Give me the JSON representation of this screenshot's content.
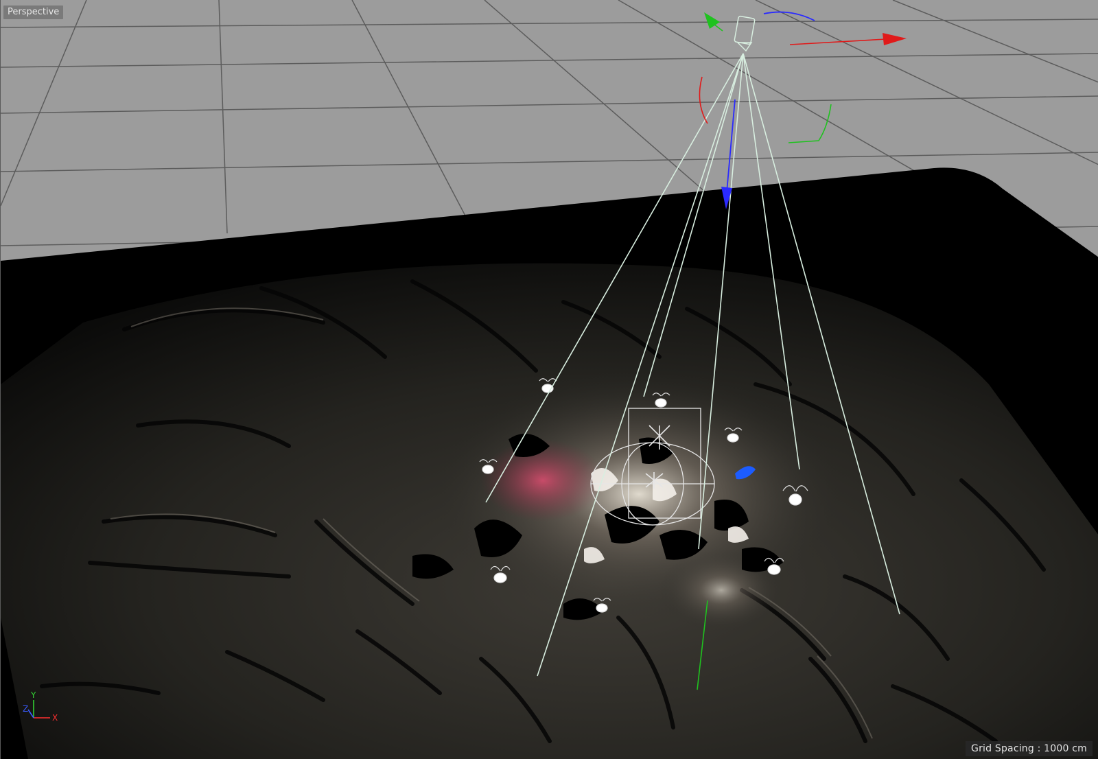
{
  "viewport": {
    "view_name": "Perspective",
    "grid_spacing_text": "Grid Spacing : 1000 cm"
  },
  "axis_indicator": {
    "x_label": "X",
    "y_label": "Y",
    "z_label": "Z",
    "x_color": "#ff3030",
    "y_color": "#33d133",
    "z_color": "#3a5cff"
  },
  "colors": {
    "floor_grid_bg": "#9c9c9c",
    "grid_line": "#5c5c5c",
    "ground_shadow": "#000000",
    "terrain": "#2a2a26",
    "frustum_line": "#d8eee0",
    "gizmo_red": "#e01a1a",
    "gizmo_green": "#1fc21f",
    "gizmo_blue": "#2a2aff"
  }
}
